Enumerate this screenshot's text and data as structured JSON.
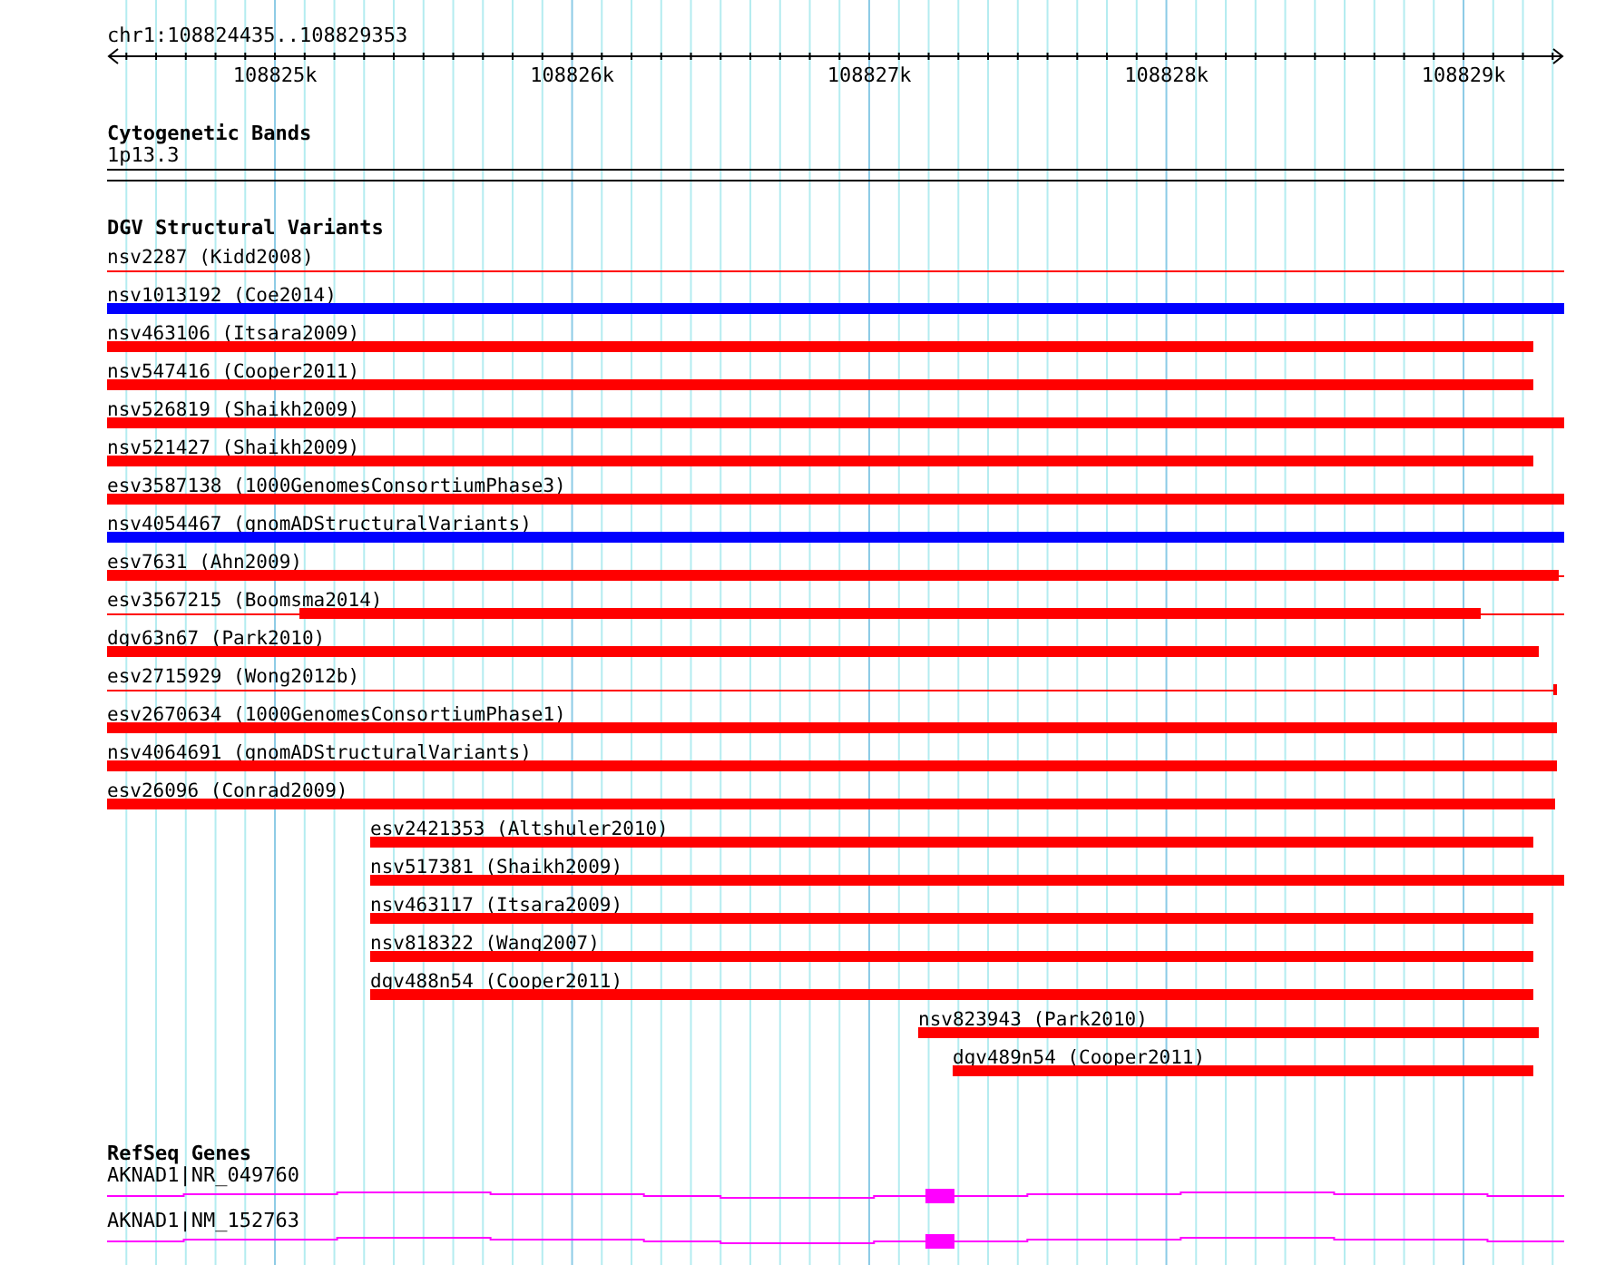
{
  "ruler": {
    "region": "chr1:108824435..108829353",
    "ticks": [
      "108825k",
      "108826k",
      "108827k",
      "108828k",
      "108829k"
    ]
  },
  "tracks": [
    {
      "title": "Cytogenetic Bands",
      "kind": "bands",
      "features": [
        {
          "label": "1p13.3"
        }
      ]
    },
    {
      "title": "DGV Structural Variants",
      "kind": "variants",
      "features": [
        {
          "label": "nsv2287 (Kidd2008)",
          "color": "#ff0000"
        },
        {
          "label": "nsv1013192 (Coe2014)",
          "color": "#0000ff"
        },
        {
          "label": "nsv463106 (Itsara2009)",
          "color": "#ff0000"
        },
        {
          "label": "nsv547416 (Cooper2011)",
          "color": "#ff0000"
        },
        {
          "label": "nsv526819 (Shaikh2009)",
          "color": "#ff0000"
        },
        {
          "label": "nsv521427 (Shaikh2009)",
          "color": "#ff0000"
        },
        {
          "label": "esv3587138 (1000GenomesConsortiumPhase3)",
          "color": "#ff0000"
        },
        {
          "label": "nsv4054467 (gnomADStructuralVariants)",
          "color": "#0000ff"
        },
        {
          "label": "esv7631 (Ahn2009)",
          "color": "#ff0000"
        },
        {
          "label": "esv3567215 (Boomsma2014)",
          "color": "#ff0000"
        },
        {
          "label": "dgv63n67 (Park2010)",
          "color": "#ff0000"
        },
        {
          "label": "esv2715929 (Wong2012b)",
          "color": "#ff0000"
        },
        {
          "label": "esv2670634 (1000GenomesConsortiumPhase1)",
          "color": "#ff0000"
        },
        {
          "label": "nsv4064691 (gnomADStructuralVariants)",
          "color": "#ff0000"
        },
        {
          "label": "esv26096 (Conrad2009)",
          "color": "#ff0000"
        },
        {
          "label": "esv2421353 (Altshuler2010)",
          "color": "#ff0000"
        },
        {
          "label": "nsv517381 (Shaikh2009)",
          "color": "#ff0000"
        },
        {
          "label": "nsv463117 (Itsara2009)",
          "color": "#ff0000"
        },
        {
          "label": "nsv818322 (Wang2007)",
          "color": "#ff0000"
        },
        {
          "label": "dgv488n54 (Cooper2011)",
          "color": "#ff0000"
        },
        {
          "label": "nsv823943 (Park2010)",
          "color": "#ff0000"
        },
        {
          "label": "dgv489n54 (Cooper2011)",
          "color": "#ff0000"
        }
      ]
    },
    {
      "title": "RefSeq Genes",
      "kind": "genes",
      "features": [
        {
          "label": "AKNAD1|NR_049760"
        },
        {
          "label": "AKNAD1|NM_152763"
        }
      ]
    }
  ]
}
